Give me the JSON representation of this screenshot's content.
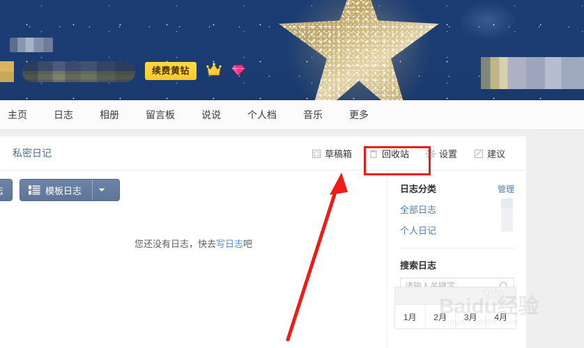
{
  "banner": {
    "renew_button_label": "续费黄钻",
    "crown_icon": "crown-icon",
    "diamond_icon": "diamond-icon",
    "star_graphic": "glitter-star-graphic",
    "background_color": "#1b3c72",
    "accent_color": "#ffd948"
  },
  "nav": {
    "items": [
      {
        "label": "主页"
      },
      {
        "label": "日志"
      },
      {
        "label": "相册"
      },
      {
        "label": "留言板"
      },
      {
        "label": "说说"
      },
      {
        "label": "个人档"
      },
      {
        "label": "音乐"
      },
      {
        "label": "更多"
      }
    ]
  },
  "panel": {
    "title": "私密日记",
    "tools": [
      {
        "label": "草稿箱",
        "icon": "draft-box-icon"
      },
      {
        "label": "回收站",
        "icon": "trash-icon"
      },
      {
        "label": "设置",
        "icon": "gear-icon"
      },
      {
        "label": "建议",
        "icon": "feedback-icon"
      }
    ]
  },
  "actions": {
    "write_button_label": "日志",
    "template_button_label": "模板日志",
    "template_icon": "list-icon",
    "dropdown_icon": "chevron-down-icon"
  },
  "main": {
    "empty_prefix": "您还没有日志，快去",
    "empty_link": "写日志",
    "empty_suffix": "吧"
  },
  "sidebar": {
    "category_title": "日志分类",
    "manage_label": "管理",
    "categories": [
      {
        "label": "全部日志"
      },
      {
        "label": "个人日记"
      }
    ],
    "search_title": "搜索日志",
    "search_placeholder": "请输入关键字",
    "search_value": "",
    "search_icon": "search-icon",
    "calendar": {
      "months": [
        "1月",
        "2月",
        "3月",
        "4月"
      ]
    }
  },
  "annotation": {
    "highlight_target": "回收站",
    "highlight_color": "#ef1c15",
    "arrow": "red-arrow-pointing-up-right"
  },
  "watermark": {
    "brand": "Baidu经验",
    "url": "jingyan.baidu.com"
  }
}
